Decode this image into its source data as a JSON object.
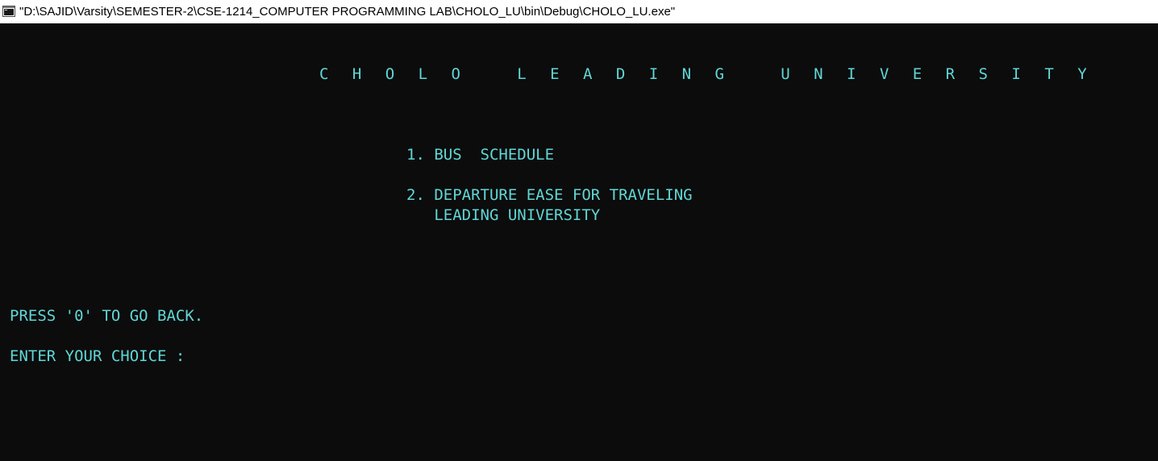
{
  "window": {
    "title": "\"D:\\SAJID\\Varsity\\SEMESTER-2\\CSE-1214_COMPUTER PROGRAMMING LAB\\CHOLO_LU\\bin\\Debug\\CHOLO_LU.exe\"",
    "icon": "console-app-icon"
  },
  "console": {
    "heading": "C H O L O   L E A D I N G   U N I V E R S I T Y",
    "menu": [
      {
        "label": "1. BUS  SCHEDULE"
      },
      {
        "label": "2. DEPARTURE EASE FOR TRAVELING"
      },
      {
        "label": "   LEADING UNIVERSITY"
      }
    ],
    "back_hint": "PRESS '0' TO GO BACK.",
    "prompt": "ENTER YOUR CHOICE :"
  },
  "colors": {
    "background": "#0c0c0c",
    "text": "#61d6d6",
    "titlebar": "#ffffff"
  }
}
